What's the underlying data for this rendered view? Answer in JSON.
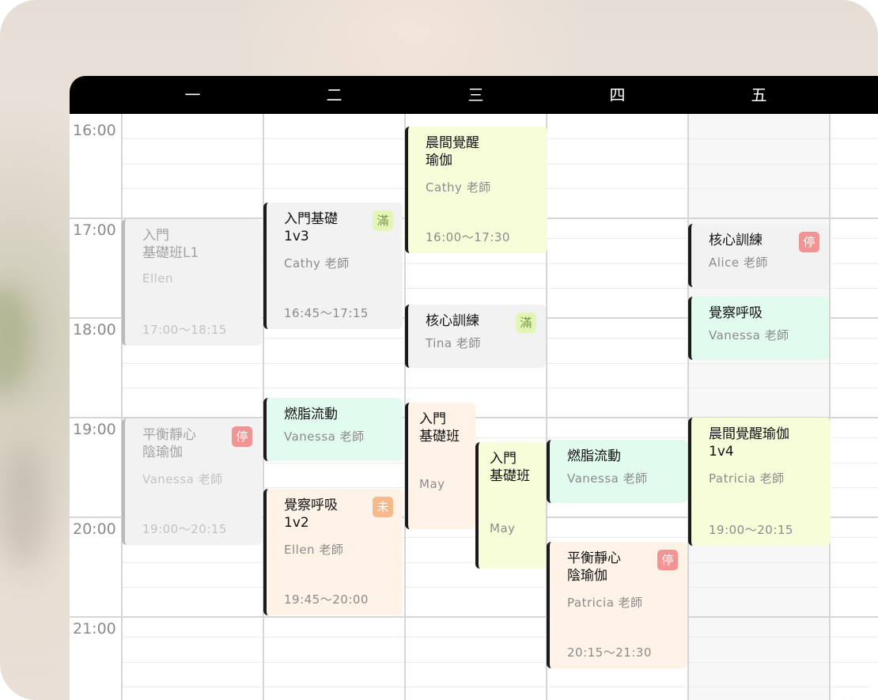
{
  "days": [
    "一",
    "二",
    "三",
    "四",
    "五"
  ],
  "times": [
    "16:00",
    "17:00",
    "18:00",
    "19:00",
    "20:00",
    "21:00"
  ],
  "classes": [
    {
      "title": "入門\n基礎班L1",
      "instructor": "Ellen",
      "time": "17:00～18:15",
      "badge": ""
    },
    {
      "title": "平衡靜心\n陰瑜伽",
      "instructor": "Vanessa 老師",
      "time": "19:00～20:15",
      "badge": "停"
    },
    {
      "title": "入門基礎\n1v3",
      "instructor": "Cathy 老師",
      "time": "16:45～17:15",
      "badge": "滿"
    },
    {
      "title": "燃脂流動",
      "instructor": "Vanessa 老師",
      "time": "",
      "badge": ""
    },
    {
      "title": "覺察呼吸\n1v2",
      "instructor": "Ellen 老師",
      "time": "19:45～20:00",
      "badge": "未"
    },
    {
      "title": "晨間覺醒\n瑜伽",
      "instructor": "Cathy 老師",
      "time": "16:00～17:30",
      "badge": ""
    },
    {
      "title": "核心訓練",
      "instructor": "Tina 老師",
      "time": "",
      "badge": "滿"
    },
    {
      "title": "入門\n基礎班",
      "instructor": "May",
      "time": "",
      "badge": ""
    },
    {
      "title": "入門\n基礎班",
      "instructor": "May",
      "time": "",
      "badge": ""
    },
    {
      "title": "燃脂流動",
      "instructor": "Vanessa 老師",
      "time": "",
      "badge": ""
    },
    {
      "title": "平衡靜心\n陰瑜伽",
      "instructor": "Patricia 老師",
      "time": "20:15～21:30",
      "badge": "停"
    },
    {
      "title": "核心訓練",
      "instructor": "Alice 老師",
      "time": "",
      "badge": "停"
    },
    {
      "title": "覺察呼吸",
      "instructor": "Vanessa 老師",
      "time": "",
      "badge": ""
    },
    {
      "title": "晨間覺醒瑜伽\n1v4",
      "instructor": "Patricia 老師",
      "time": "19:00～20:15",
      "badge": ""
    }
  ]
}
